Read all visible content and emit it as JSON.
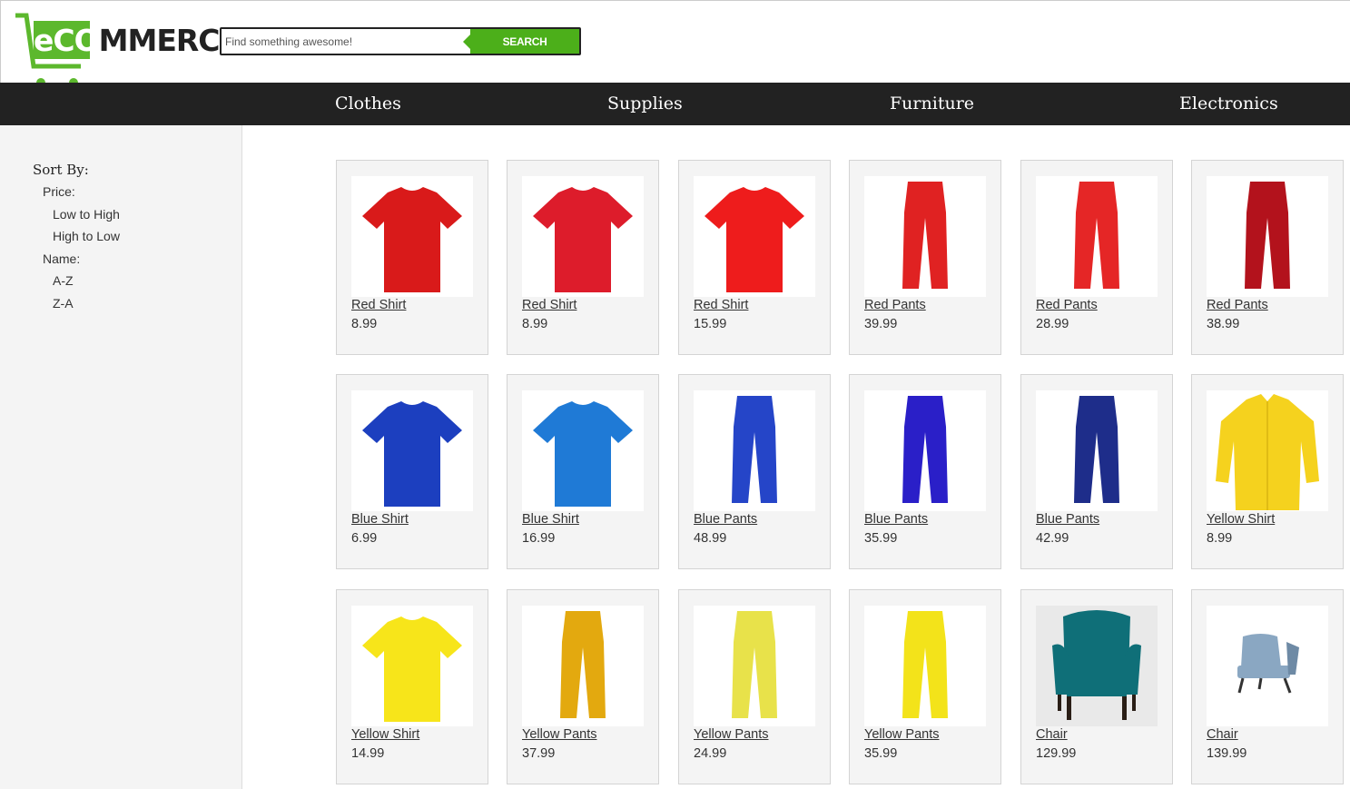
{
  "logo": {
    "text_e": "e",
    "text_co": "CO",
    "text_rest": "MMERCE",
    "brand_color": "#5cb82d"
  },
  "search": {
    "placeholder": "Find something awesome!",
    "button_label": "SEARCH"
  },
  "nav": [
    {
      "label": "Clothes"
    },
    {
      "label": "Supplies"
    },
    {
      "label": "Furniture"
    },
    {
      "label": "Electronics"
    }
  ],
  "sidebar": {
    "title": "Sort By:",
    "price_label": "Price:",
    "price_low_high": "Low to High",
    "price_high_low": "High to Low",
    "name_label": "Name:",
    "name_az": "A-Z",
    "name_za": "Z-A"
  },
  "products": [
    {
      "name": "Red Shirt",
      "price": "8.99",
      "icon": "tshirt",
      "color": "#d91a1a"
    },
    {
      "name": "Red Shirt",
      "price": "8.99",
      "icon": "tshirt",
      "color": "#dd1c2b"
    },
    {
      "name": "Red Shirt",
      "price": "15.99",
      "icon": "tshirt",
      "color": "#ee1c1c"
    },
    {
      "name": "Red Pants",
      "price": "39.99",
      "icon": "pants",
      "color": "#e02222"
    },
    {
      "name": "Red Pants",
      "price": "28.99",
      "icon": "pants",
      "color": "#e52626"
    },
    {
      "name": "Red Pants",
      "price": "38.99",
      "icon": "pants",
      "color": "#b3121c"
    },
    {
      "name": "Blue Shirt",
      "price": "6.99",
      "icon": "tshirt",
      "color": "#1c3fbf"
    },
    {
      "name": "Blue Shirt",
      "price": "16.99",
      "icon": "tshirt",
      "color": "#1f7ad6"
    },
    {
      "name": "Blue Pants",
      "price": "48.99",
      "icon": "pants",
      "color": "#2545c8"
    },
    {
      "name": "Blue Pants",
      "price": "35.99",
      "icon": "pants",
      "color": "#2a1fc8"
    },
    {
      "name": "Blue Pants",
      "price": "42.99",
      "icon": "pants",
      "color": "#1e2d8a"
    },
    {
      "name": "Yellow Shirt",
      "price": "8.99",
      "icon": "dress-shirt",
      "color": "#f5d21e"
    },
    {
      "name": "Yellow Shirt",
      "price": "14.99",
      "icon": "tshirt",
      "color": "#f7e51a"
    },
    {
      "name": "Yellow Pants",
      "price": "37.99",
      "icon": "pants",
      "color": "#e3a90f"
    },
    {
      "name": "Yellow Pants",
      "price": "24.99",
      "icon": "pants",
      "color": "#e8e24a"
    },
    {
      "name": "Yellow Pants",
      "price": "35.99",
      "icon": "pants",
      "color": "#f3e31a"
    },
    {
      "name": "Chair",
      "price": "129.99",
      "icon": "armchair",
      "color": "#0f6f78"
    },
    {
      "name": "Chair",
      "price": "139.99",
      "icon": "lounge-chair",
      "color": "#8aa7c2"
    }
  ]
}
